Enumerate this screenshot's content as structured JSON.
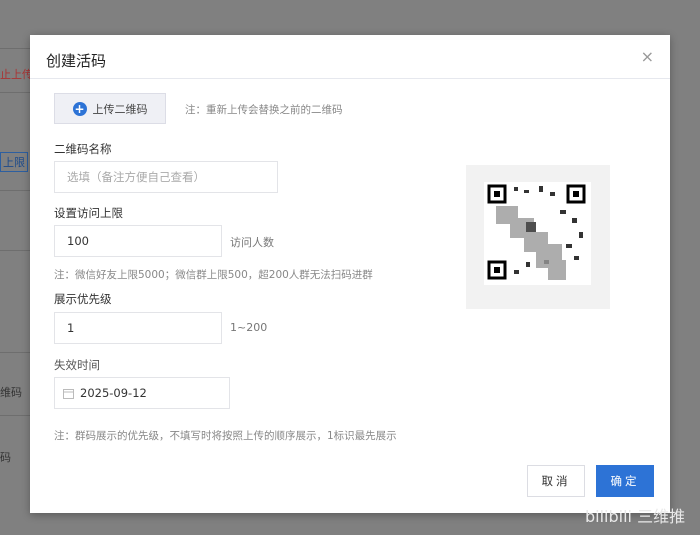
{
  "background": {
    "texts": [
      "止上传",
      "上限",
      "维码",
      "码"
    ]
  },
  "dialog": {
    "title": "创建活码",
    "close": "×",
    "upload_label": "上传二维码",
    "upload_note": "注：重新上传会替换之前的二维码",
    "name_label": "二维码名称",
    "name_placeholder": "选填（备注方便自己查看）",
    "limit_label": "设置访问上限",
    "limit_value": "100",
    "limit_suffix": "访问人数",
    "limit_note": "注：微信好友上限5000；微信群上限500，超200人群无法扫码进群",
    "priority_label": "展示优先级",
    "priority_value": "1",
    "priority_suffix": "1~200",
    "expiry_label": "失效时间",
    "expiry_value": "2025-09-12",
    "priority_note": "注：群码展示的优先级，不填写时将按照上传的顺序展示，1标识最先展示",
    "cancel": "取消",
    "confirm": "确定"
  },
  "watermark": "bilibili 三维推",
  "colors": {
    "primary": "#2d73d6"
  }
}
